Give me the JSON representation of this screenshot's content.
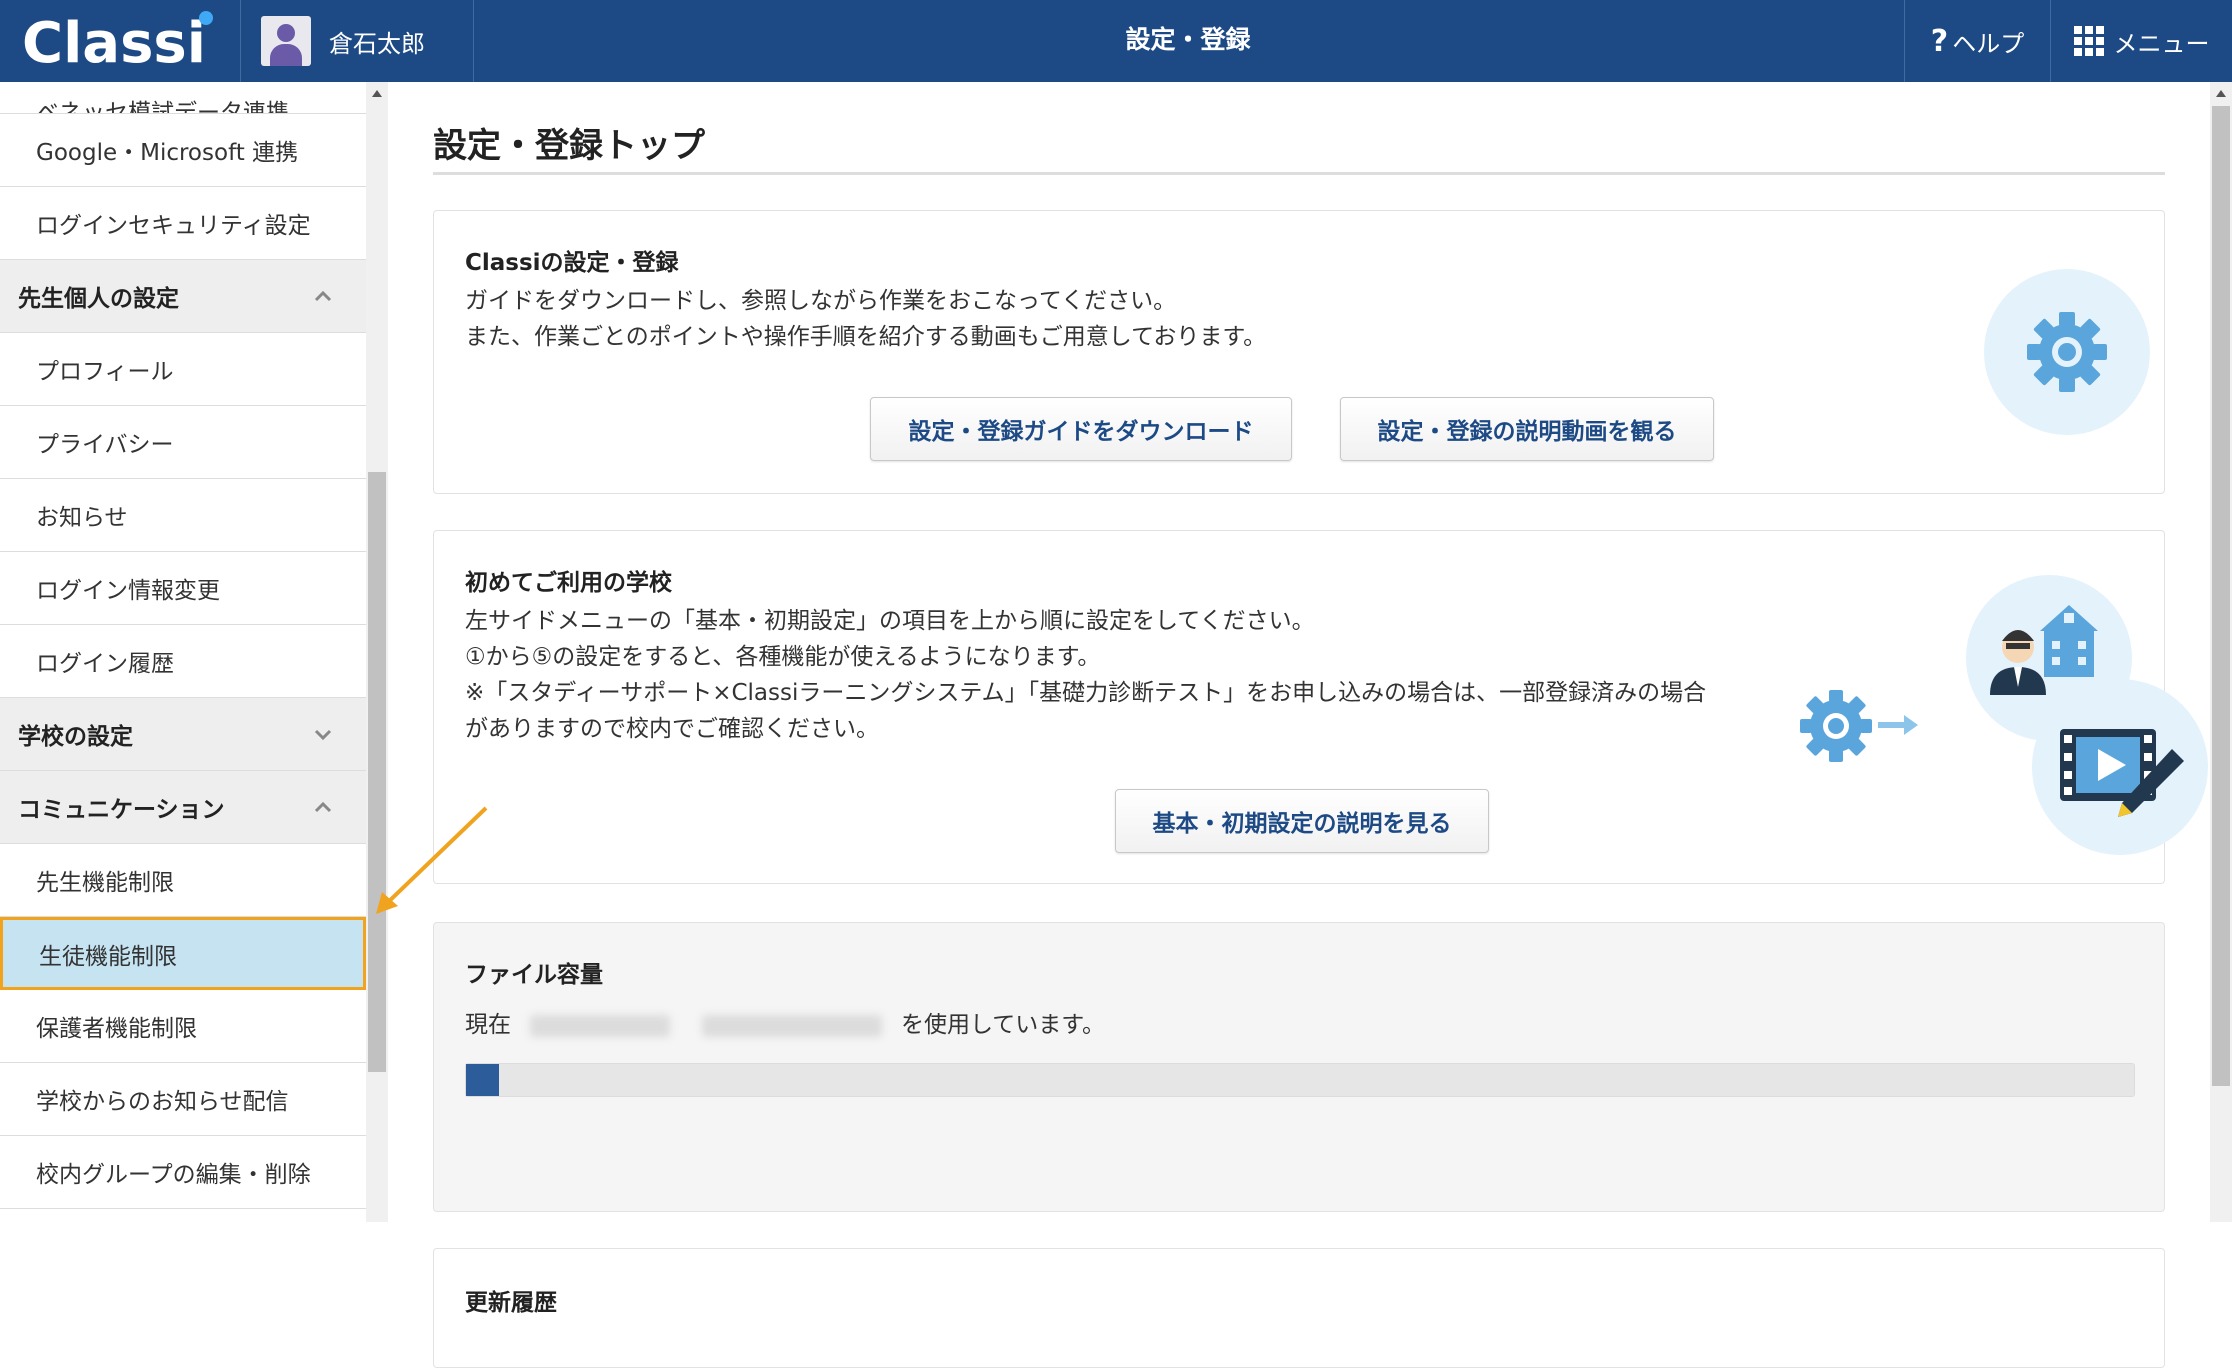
{
  "header": {
    "logo_text": "Classi",
    "user_name": "倉石太郎",
    "title": "設定・登録",
    "help_label": "ヘルプ",
    "help_symbol": "?",
    "menu_label": "メニュー"
  },
  "sidebar": {
    "items": [
      {
        "type": "item",
        "label": "ベネッセ模試データ連携",
        "state": "cut"
      },
      {
        "type": "item",
        "label": "Google・Microsoft 連携"
      },
      {
        "type": "item",
        "label": "ログインセキュリティ設定"
      },
      {
        "type": "section",
        "label": "先生個人の設定",
        "expanded": true
      },
      {
        "type": "item",
        "label": "プロフィール"
      },
      {
        "type": "item",
        "label": "プライバシー"
      },
      {
        "type": "item",
        "label": "お知らせ"
      },
      {
        "type": "item",
        "label": "ログイン情報変更"
      },
      {
        "type": "item",
        "label": "ログイン履歴"
      },
      {
        "type": "section",
        "label": "学校の設定",
        "expanded": false
      },
      {
        "type": "section",
        "label": "コミュニケーション",
        "expanded": true
      },
      {
        "type": "item",
        "label": "先生機能制限"
      },
      {
        "type": "item",
        "label": "生徒機能制限",
        "active": true
      },
      {
        "type": "item",
        "label": "保護者機能制限"
      },
      {
        "type": "item",
        "label": "学校からのお知らせ配信"
      },
      {
        "type": "item",
        "label": "校内グループの編集・削除"
      }
    ]
  },
  "main": {
    "page_title": "設定・登録トップ",
    "settings_card": {
      "heading": "Classiの設定・登録",
      "lines": [
        "ガイドをダウンロードし、参照しながら作業をおこなってください。",
        "また、作業ごとのポイントや操作手順を紹介する動画もご用意しております。"
      ],
      "download_button": "設定・登録ガイドをダウンロード",
      "video_button": "設定・登録の説明動画を観る"
    },
    "first_card": {
      "heading": "初めてご利用の学校",
      "lines": [
        "左サイドメニューの「基本・初期設定」の項目を上から順に設定をしてください。",
        "①から⑤の設定をすると、各種機能が使えるようになります。",
        "※「スタディーサポート×Classiラーニングシステム」「基礎力診断テスト」をお申し込みの場合は、一部登録済みの場合",
        "がありますので校内でご確認ください。"
      ],
      "button": "基本・初期設定の説明を見る"
    },
    "file_card": {
      "heading": "ファイル容量",
      "prefix": "現在",
      "suffix": "を使用しています。",
      "usage_fraction": 0.002
    },
    "history_card": {
      "heading": "更新履歴"
    }
  },
  "colors": {
    "header_bg": "#1d4a85",
    "active_bg": "#c6e3f2",
    "active_border": "#f3a21c",
    "icon_blue": "#5aa6dc",
    "arrow": "#f0a31f"
  }
}
